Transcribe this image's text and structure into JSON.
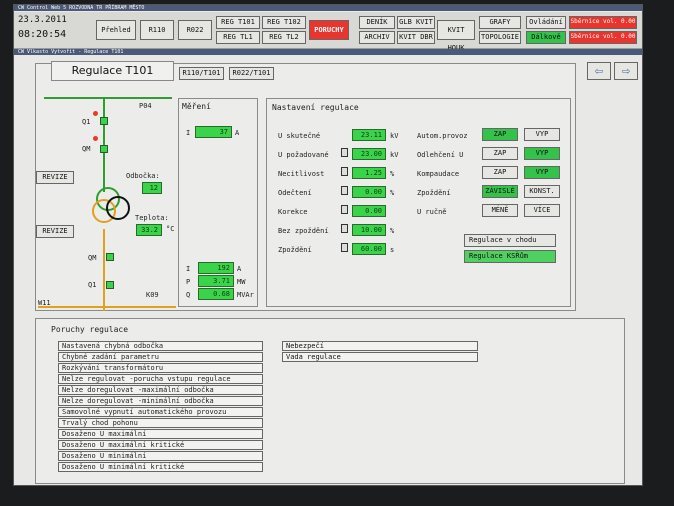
{
  "app": {
    "titlebar": "CW Control Web 5   ROZVODNA TR PŘÍBRAM MĚSTO",
    "window_caption": "CW Vlkasto Vytvořit - Regulace T101"
  },
  "toolbar": {
    "date": "23.3.2011",
    "time": "08:20:54",
    "prehled": "Přehled",
    "r110": "R110",
    "r022": "R022",
    "reg_t101": "REG T101",
    "reg_t102": "REG T102",
    "reg_tl1": "REG TL1",
    "reg_tl2": "REG TL2",
    "poruchy": "PORUCHY",
    "denik": "DENÍK",
    "archiv": "ARCHIV",
    "glb_kvit": "GLB KVIT",
    "kvit_dbr": "KVIT DBR",
    "kvit_houk": "KVIT HOUK",
    "grafy": "GRAFY",
    "topologie": "TOPOLOGIE",
    "ovladani": "Ovládání",
    "dalkove": "Dálkově",
    "alarm1": "Sběrnice vol. 0.00",
    "alarm2": "Sběrnice vol. 0.00"
  },
  "page": {
    "title": "Regulace T101",
    "nav1": "R110/T101",
    "nav2": "R022/T101",
    "back_glyph": "⇦",
    "fwd_glyph": "⇨"
  },
  "scheme": {
    "p04": "P04",
    "q1": "Q1",
    "qm": "QM",
    "revize": "REVIZE",
    "odbocka": "Odbočka:",
    "odbocka_val": "12",
    "teplota": "Teplota:",
    "teplota_val": "33.2",
    "teplota_unit": "°C",
    "qm2": "QM",
    "q1b": "Q1",
    "w11": "W11",
    "k09": "K09"
  },
  "mereni": {
    "title": "Měření",
    "i_top": {
      "label": "I",
      "value": "37",
      "unit": "A"
    },
    "rows": [
      {
        "label": "I",
        "value": "192",
        "unit": "A"
      },
      {
        "label": "P",
        "value": "3.71",
        "unit": "MW"
      },
      {
        "label": "Q",
        "value": "0.68",
        "unit": "MVAr"
      }
    ]
  },
  "nastaveni": {
    "title": "Nastavení regulace",
    "left": [
      {
        "label": "U skutečné",
        "value": "23.11",
        "unit": "kV"
      },
      {
        "label": "U požadované",
        "value": "23.00",
        "unit": "kV"
      },
      {
        "label": "Necitlivost",
        "value": "1.25",
        "unit": "%"
      },
      {
        "label": "Odečtení",
        "value": "0.00",
        "unit": "%"
      },
      {
        "label": "Korekce",
        "value": "0.00",
        "unit": ""
      },
      {
        "label": "Bez zpoždění",
        "value": "10.00",
        "unit": "%"
      },
      {
        "label": "Zpoždění",
        "value": "60.00",
        "unit": "s"
      }
    ],
    "right": [
      {
        "label": "Autom.provoz",
        "a": "ZAP",
        "b": "VYP"
      },
      {
        "label": "Odlehčení U",
        "a": "ZAP",
        "b": "VYP"
      },
      {
        "label": "Kompaudace",
        "a": "ZAP",
        "b": "VYP"
      },
      {
        "label": "Zpoždění",
        "a": "ZÁVISLÉ",
        "b": "KONST."
      },
      {
        "label": "U ručně",
        "a": "MÉNĚ",
        "b": "VÍCE"
      }
    ],
    "status1": "Regulace v chodu",
    "status2": "Regulace KSŘům"
  },
  "poruchy": {
    "title": "Poruchy regulace",
    "items": [
      "Nastavená chybná odbočka",
      "Chybné zadání parametru",
      "Rozkývání transformátoru",
      "Nelze regulovat -porucha vstupu regulace",
      "Nelze doregulovat -maximální odbočka",
      "Nelze doregulovat -minimální odbočka",
      "Samovolné vypnutí automatického provozu",
      "Trvalý chod pohonu",
      "Dosaženo U maximální",
      "Dosaženo U maximální kritické",
      "Dosaženo U minimální",
      "Dosaženo U minimální kritické"
    ],
    "right_items": [
      "Nebezpečí",
      "Vada regulace"
    ]
  }
}
